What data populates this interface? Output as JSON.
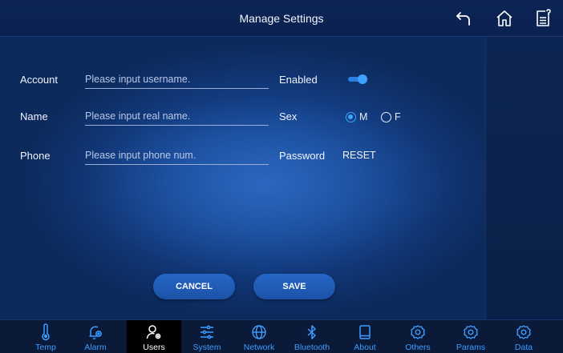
{
  "header": {
    "title": "Manage Settings",
    "icons": [
      "back-arrow-icon",
      "home-icon",
      "notes-icon"
    ]
  },
  "form": {
    "account": {
      "label": "Account",
      "placeholder": "Please input username."
    },
    "name": {
      "label": "Name",
      "placeholder": "Please input real name."
    },
    "phone": {
      "label": "Phone",
      "placeholder": "Please input phone num."
    },
    "enabled": {
      "label": "Enabled",
      "on": true
    },
    "sex": {
      "label": "Sex",
      "options": [
        "M",
        "F"
      ],
      "selected": "M"
    },
    "password": {
      "label": "Password",
      "action": "RESET"
    }
  },
  "buttons": {
    "cancel": "CANCEL",
    "save": "SAVE"
  },
  "nav": {
    "items": [
      {
        "label": "Temp",
        "icon": "thermometer-icon"
      },
      {
        "label": "Alarm",
        "icon": "alarm-bell-icon"
      },
      {
        "label": "Users",
        "icon": "user-settings-icon",
        "active": true
      },
      {
        "label": "System",
        "icon": "sliders-icon"
      },
      {
        "label": "Network",
        "icon": "globe-icon"
      },
      {
        "label": "Bluetooth",
        "icon": "bluetooth-icon"
      },
      {
        "label": "About",
        "icon": "tablet-icon"
      },
      {
        "label": "Others",
        "icon": "gear-icon"
      },
      {
        "label": "Params",
        "icon": "gear-icon"
      },
      {
        "label": "Data",
        "icon": "gear-icon"
      }
    ]
  },
  "colors": {
    "accent": "#3ea0ff",
    "nav_label": "#3f9dff",
    "background": "#0a1d3f"
  }
}
